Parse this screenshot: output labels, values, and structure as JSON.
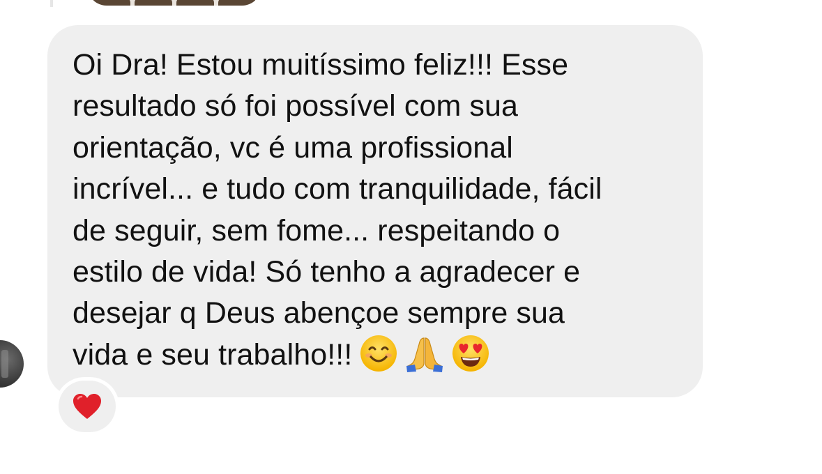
{
  "message": {
    "lines": [
      "Oi Dra! Estou muitíssimo feliz!!! Esse",
      "resultado só foi possível com sua",
      "orientação, vc é uma profissional",
      "incrível... e tudo com tranquilidade, fácil",
      "de seguir, sem fome... respeitando o",
      "estilo de vida! Só tenho a agradecer e",
      "desejar q Deus abençoe sempre sua",
      "vida e seu trabalho!!!"
    ],
    "emojis": [
      "smiling-face-icon",
      "folded-hands-icon",
      "heart-eyes-icon"
    ]
  },
  "reaction": {
    "icon": "red-heart-icon",
    "color": "#e0202a"
  },
  "colors": {
    "bubble": "#efefef",
    "text": "#111111",
    "background": "#ffffff"
  }
}
